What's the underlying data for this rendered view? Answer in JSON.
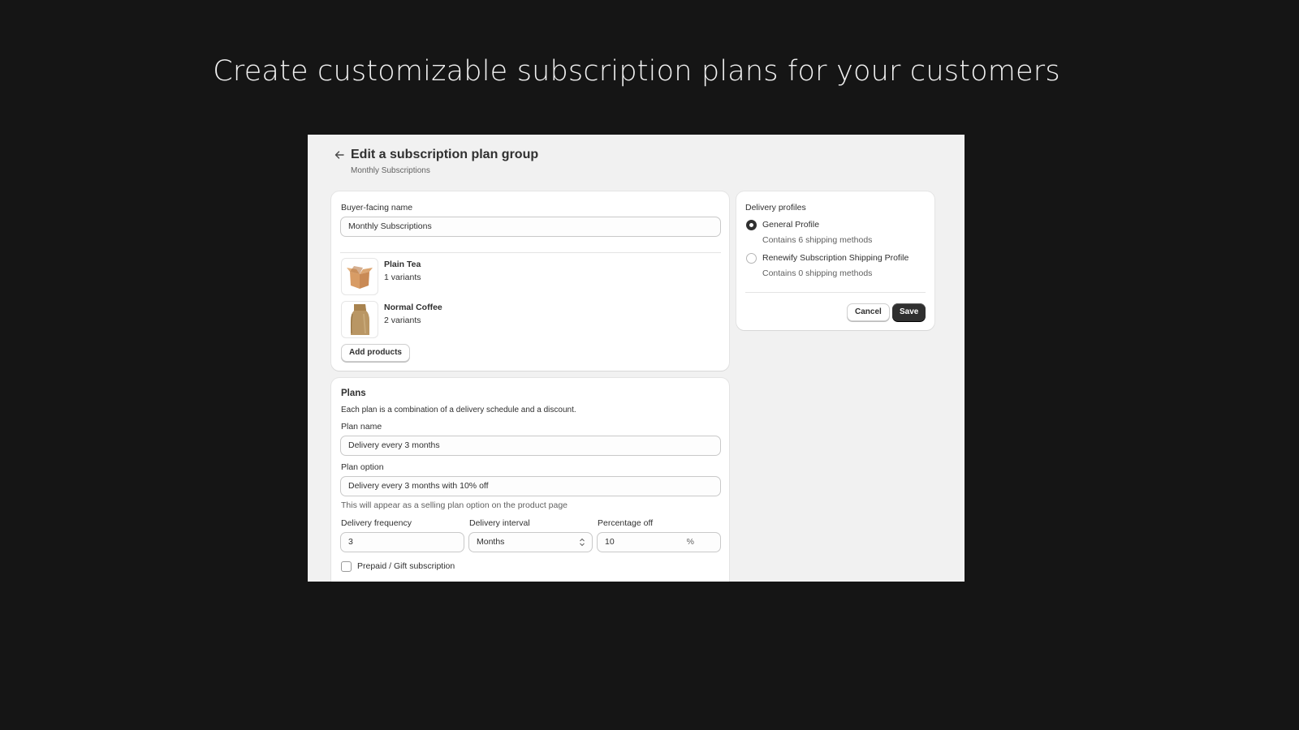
{
  "headline": "Create customizable subscription plans for your customers",
  "page": {
    "title": "Edit a subscription plan group",
    "subtitle": "Monthly Subscriptions",
    "back_icon": "arrow-left-icon"
  },
  "products_card": {
    "buyer_name_label": "Buyer-facing name",
    "buyer_name_value": "Monthly Subscriptions",
    "products": [
      {
        "name": "Plain Tea",
        "variants": "1 variants",
        "icon": "cardboard-box-image"
      },
      {
        "name": "Normal Coffee",
        "variants": "2 variants",
        "icon": "coffee-bag-image"
      }
    ],
    "add_products_label": "Add products"
  },
  "plans_card": {
    "title": "Plans",
    "description": "Each plan is a combination of a delivery schedule and a discount.",
    "plan_name_label": "Plan name",
    "plan_name_value": "Delivery every 3 months",
    "plan_option_label": "Plan option",
    "plan_option_value": "Delivery every 3 months with 10% off",
    "plan_option_hint": "This will appear as a selling plan option on the product page",
    "delivery_frequency_label": "Delivery frequency",
    "delivery_frequency_value": "3",
    "delivery_interval_label": "Delivery interval",
    "delivery_interval_value": "Months",
    "percentage_off_label": "Percentage off",
    "percentage_off_value": "10",
    "percentage_suffix": "%",
    "prepaid_label": "Prepaid / Gift subscription",
    "prepaid_checked": false
  },
  "delivery_card": {
    "title": "Delivery profiles",
    "profiles": [
      {
        "name": "General Profile",
        "detail": "Contains 6 shipping methods",
        "selected": true
      },
      {
        "name": "Renewify Subscription Shipping Profile",
        "detail": "Contains 0 shipping methods",
        "selected": false
      }
    ],
    "cancel_label": "Cancel",
    "save_label": "Save"
  }
}
